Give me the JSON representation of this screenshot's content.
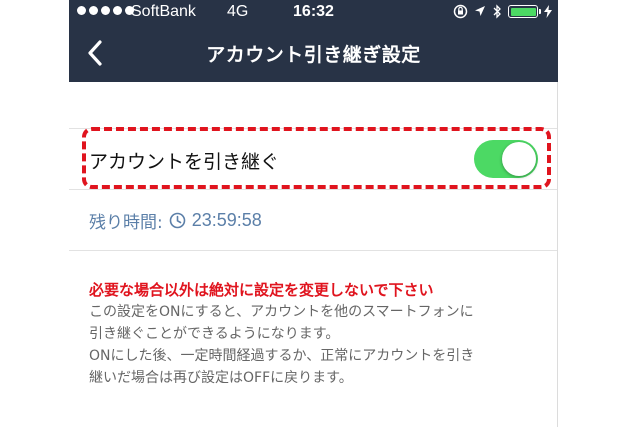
{
  "status_bar": {
    "carrier": "SoftBank",
    "network": "4G",
    "time": "16:32",
    "icons": [
      "signal-dots-icon",
      "rotation-lock-icon",
      "location-arrow-icon",
      "bluetooth-icon",
      "battery-icon",
      "charging-bolt-icon"
    ]
  },
  "nav": {
    "back_icon": "chevron-left-icon",
    "title": "アカウント引き継ぎ設定"
  },
  "setting": {
    "label": "アカウントを引き継ぐ",
    "toggle_on": true
  },
  "remaining": {
    "label": "残り時間:",
    "icon": "clock-icon",
    "time": "23:59:58"
  },
  "notes": {
    "warning": "必要な場合以外は絶対に設定を変更しないで下さい",
    "line1": "この設定をONにすると、アカウントを他のスマートフォンに",
    "line2": "引き継ぐことができるようになります。",
    "line3": "ONにした後、一定時間経過するか、正常にアカウントを引き",
    "line4": "継いだ場合は再び設定はOFFに戻ります。"
  },
  "colors": {
    "nav_background": "#283346",
    "toggle_on": "#4cd964",
    "highlight": "#e0141e",
    "remaining_text": "#5b7fa8",
    "warning_text": "#e0141e"
  }
}
